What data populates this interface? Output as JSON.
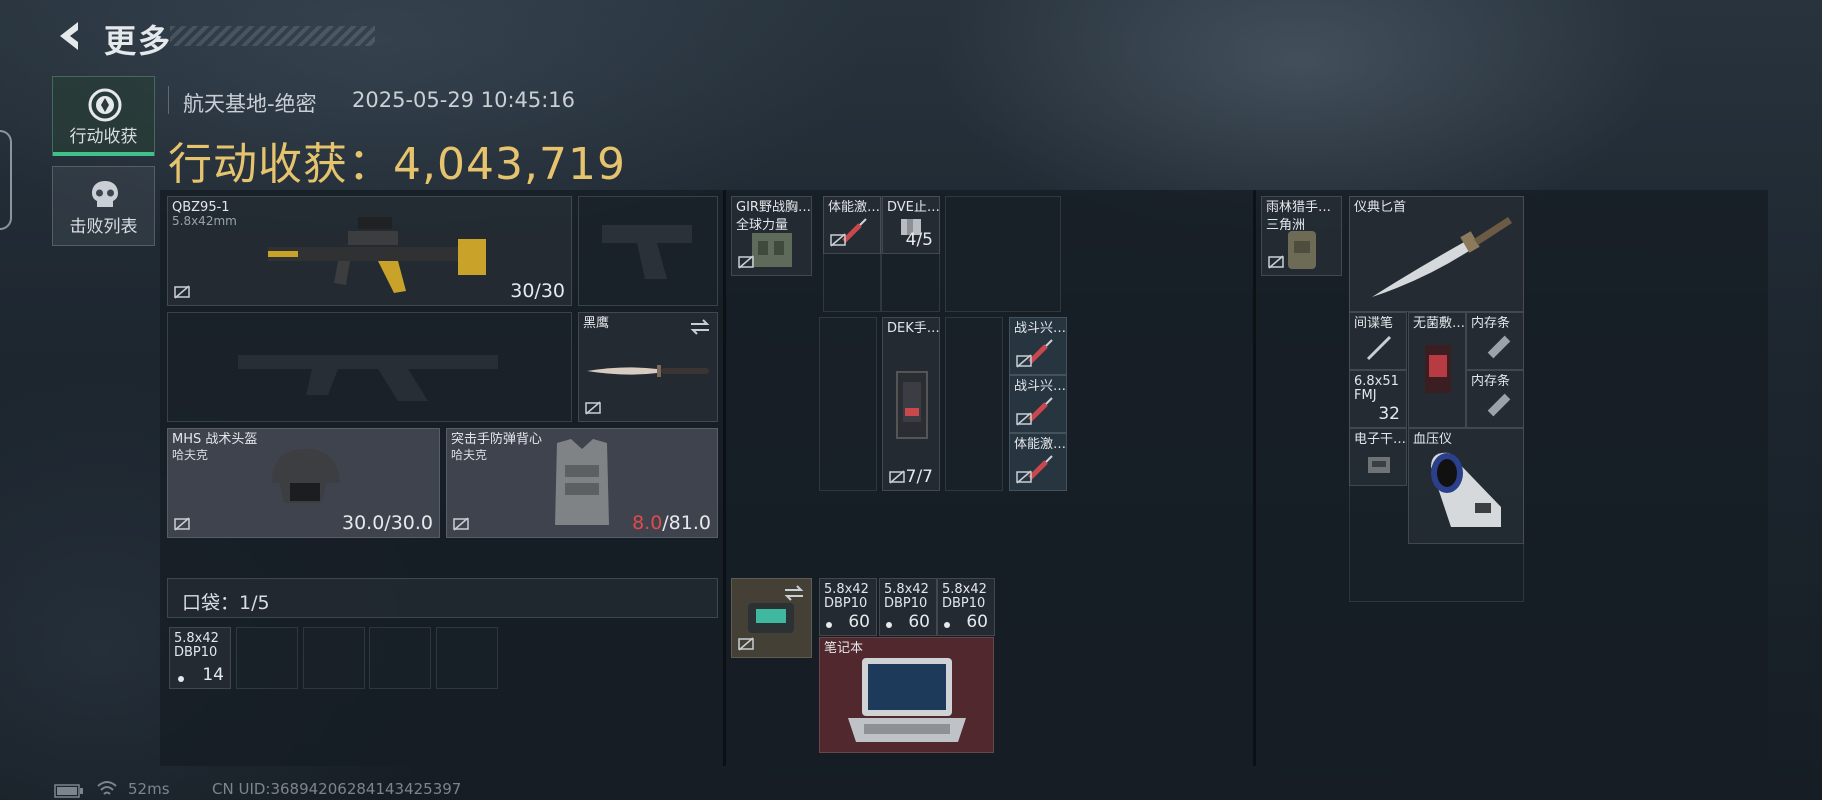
{
  "header": {
    "title": "更多"
  },
  "nav": [
    {
      "label": "行动收获",
      "icon": "loot-icon",
      "active": true
    },
    {
      "label": "击败列表",
      "icon": "skull-icon",
      "active": false
    }
  ],
  "info": {
    "location": "航天基地-绝密",
    "datetime": "2025-05-29 10:45:16",
    "haul_label": "行动收获：",
    "haul_value": "4,043,719"
  },
  "loadout": {
    "primary": {
      "name": "QBZ95-1",
      "caliber": "5.8x42mm",
      "ammo": "30/30"
    },
    "melee": {
      "name": "黑鹰"
    },
    "helmet": {
      "name": "MHS 战术头盔",
      "sub": "哈夫克",
      "durability": "30.0/30.0"
    },
    "armor": {
      "name": "突击手防弹背心",
      "sub": "哈夫克",
      "durability_current": "8.0",
      "durability_max": "/81.0"
    },
    "pocket": {
      "label": "口袋：1/5",
      "item": {
        "name": "5.8x42",
        "sub": "DBP10",
        "count": "14"
      }
    }
  },
  "chest": {
    "rig": {
      "name": "GIR野战胸…",
      "sub": "全球力量"
    },
    "items": [
      {
        "name": "体能激…"
      },
      {
        "name": "DVE止…",
        "count": "4/5"
      },
      {
        "name": "DEK手…",
        "count": "7/7"
      },
      {
        "name": "战斗兴…"
      },
      {
        "name": "战斗兴…"
      },
      {
        "name": "体能激…"
      }
    ]
  },
  "backpack_items": [
    {
      "name": "5.8x42",
      "sub": "DBP10",
      "count": "60"
    },
    {
      "name": "5.8x42",
      "sub": "DBP10",
      "count": "60"
    },
    {
      "name": "5.8x42",
      "sub": "DBP10",
      "count": "60"
    },
    {
      "name": "笔记本"
    }
  ],
  "bag": {
    "name": "雨林猎手…",
    "sub": "三角洲",
    "items": [
      {
        "name": "仪典匕首"
      },
      {
        "name": "间谍笔"
      },
      {
        "name": "无菌敷…"
      },
      {
        "name": "内存条"
      },
      {
        "name": "6.8x51",
        "sub": "FMJ",
        "count": "32"
      },
      {
        "name": "内存条"
      },
      {
        "name": "电子干…"
      },
      {
        "name": "血压仪"
      }
    ]
  },
  "status": {
    "ping": "52ms",
    "uid": "CN UID:36894206284143425397"
  },
  "colors": {
    "accent": "#e6c36d",
    "active_nav": "#3ec28a",
    "low_durability": "#e14a4a"
  }
}
